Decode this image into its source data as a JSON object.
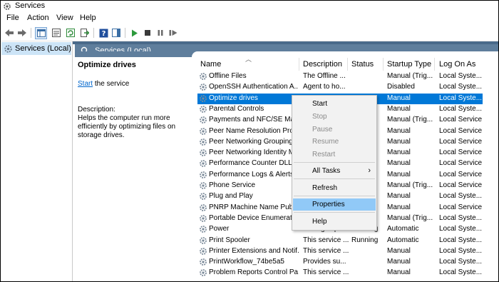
{
  "window": {
    "title": "Services"
  },
  "menu": [
    "File",
    "Action",
    "View",
    "Help"
  ],
  "tree": {
    "root_label": "Services (Local)"
  },
  "panel": {
    "header": "Services (Local)"
  },
  "detail": {
    "title": "Optimize drives",
    "start_link": "Start",
    "start_suffix": " the service",
    "description_label": "Description:",
    "description": "Helps the computer run more efficiently by optimizing files on storage drives."
  },
  "columns": [
    "Name",
    "Description",
    "Status",
    "Startup Type",
    "Log On As"
  ],
  "rows": [
    {
      "name": "Offline Files",
      "desc": "The Offline ...",
      "status": "",
      "startup": "Manual (Trig...",
      "logon": "Local Syste..."
    },
    {
      "name": "OpenSSH Authentication A...",
      "desc": "Agent to ho...",
      "status": "",
      "startup": "Disabled",
      "logon": "Local Syste..."
    },
    {
      "name": "Optimize drives",
      "desc": "",
      "status": "",
      "startup": "Manual",
      "logon": "Local Syste...",
      "selected": true
    },
    {
      "name": "Parental Controls",
      "desc": "",
      "status": "",
      "startup": "Manual",
      "logon": "Local Syste..."
    },
    {
      "name": "Payments and NFC/SE Man",
      "desc": "",
      "status": "",
      "startup": "Manual (Trig...",
      "logon": "Local Service"
    },
    {
      "name": "Peer Name Resolution Prot...",
      "desc": "",
      "status": "",
      "startup": "Manual",
      "logon": "Local Service"
    },
    {
      "name": "Peer Networking Grouping",
      "desc": "",
      "status": "",
      "startup": "Manual",
      "logon": "Local Service"
    },
    {
      "name": "Peer Networking Identity M",
      "desc": "",
      "status": "",
      "startup": "Manual",
      "logon": "Local Service"
    },
    {
      "name": "Performance Counter DLL ...",
      "desc": "",
      "status": "",
      "startup": "Manual",
      "logon": "Local Service"
    },
    {
      "name": "Performance Logs & Alerts",
      "desc": "",
      "status": "",
      "startup": "Manual",
      "logon": "Local Service"
    },
    {
      "name": "Phone Service",
      "desc": "",
      "status": "",
      "startup": "Manual (Trig...",
      "logon": "Local Service"
    },
    {
      "name": "Plug and Play",
      "desc": "",
      "status": "",
      "startup": "Manual",
      "logon": "Local Syste..."
    },
    {
      "name": "PNRP Machine Name Publi",
      "desc": "",
      "status": "",
      "startup": "Manual",
      "logon": "Local Service"
    },
    {
      "name": "Portable Device Enumerator",
      "desc": "",
      "status": "",
      "startup": "Manual (Trig...",
      "logon": "Local Syste..."
    },
    {
      "name": "Power",
      "desc": "Manages po...",
      "status": "Running",
      "startup": "Automatic",
      "logon": "Local Syste..."
    },
    {
      "name": "Print Spooler",
      "desc": "This service ...",
      "status": "Running",
      "startup": "Automatic",
      "logon": "Local Syste..."
    },
    {
      "name": "Printer Extensions and Notif...",
      "desc": "This service ...",
      "status": "",
      "startup": "Manual",
      "logon": "Local Syste..."
    },
    {
      "name": "PrintWorkflow_74be5a5",
      "desc": "Provides su...",
      "status": "",
      "startup": "Manual",
      "logon": "Local Syste..."
    },
    {
      "name": "Problem Reports Control Pa...",
      "desc": "This service ...",
      "status": "",
      "startup": "Manual",
      "logon": "Local Syste..."
    }
  ],
  "context_menu": {
    "items": [
      {
        "label": "Start",
        "disabled": false
      },
      {
        "label": "Stop",
        "disabled": true
      },
      {
        "label": "Pause",
        "disabled": true
      },
      {
        "label": "Resume",
        "disabled": true
      },
      {
        "label": "Restart",
        "disabled": true
      },
      {
        "label": "All Tasks",
        "disabled": false,
        "submenu": true
      },
      {
        "label": "Refresh",
        "disabled": false
      },
      {
        "label": "Properties",
        "disabled": false,
        "highlighted": true
      },
      {
        "label": "Help",
        "disabled": false
      }
    ]
  },
  "colors": {
    "selection": "#0078d7",
    "header": "#5f7e9c",
    "highlight": "#91c9f7"
  }
}
